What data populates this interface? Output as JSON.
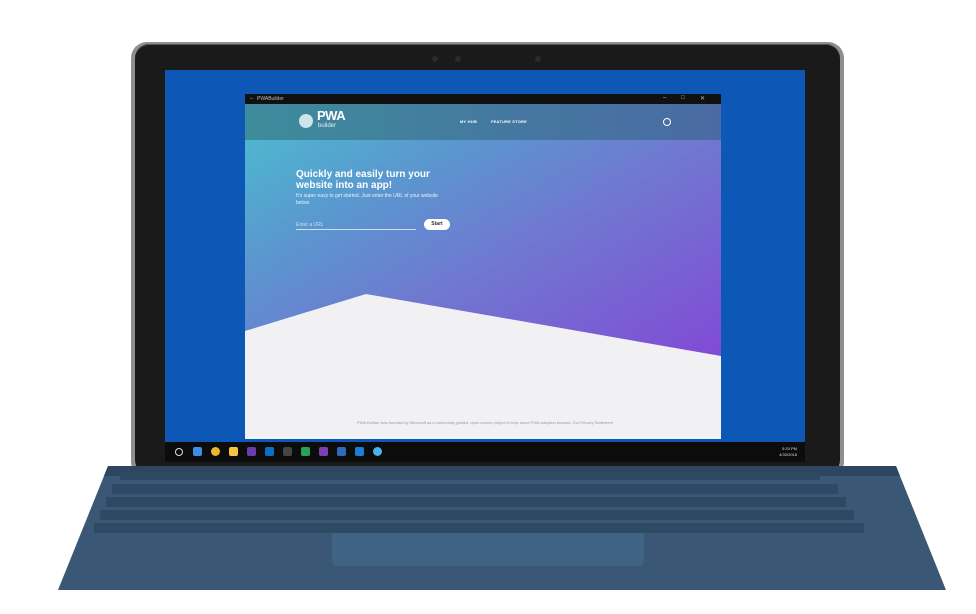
{
  "window": {
    "title": "PWABuilder"
  },
  "nav": {
    "logo_text": "PWA",
    "logo_sub": "builder",
    "links": [
      "MY HUB",
      "FEATURE STORE"
    ]
  },
  "hero": {
    "headline": "Quickly and easily turn your website into an app!",
    "subtext": "It's super easy to get started. Just enter the URL of your website below.",
    "input_placeholder": "Enter a URL",
    "start_label": "Start"
  },
  "footer": {
    "text": "PWA Builder was founded by Microsoft as a community guided, open source project to help move PWA adoption forward. Our Privacy Statement"
  },
  "taskbar": {
    "time": "5:33 PM",
    "date": "4/30/2018"
  },
  "colors": {
    "desktop": "#0d57b6",
    "gradient_start": "#4bbfcf",
    "gradient_end": "#8248d6",
    "keyboard": "#3a5876"
  }
}
